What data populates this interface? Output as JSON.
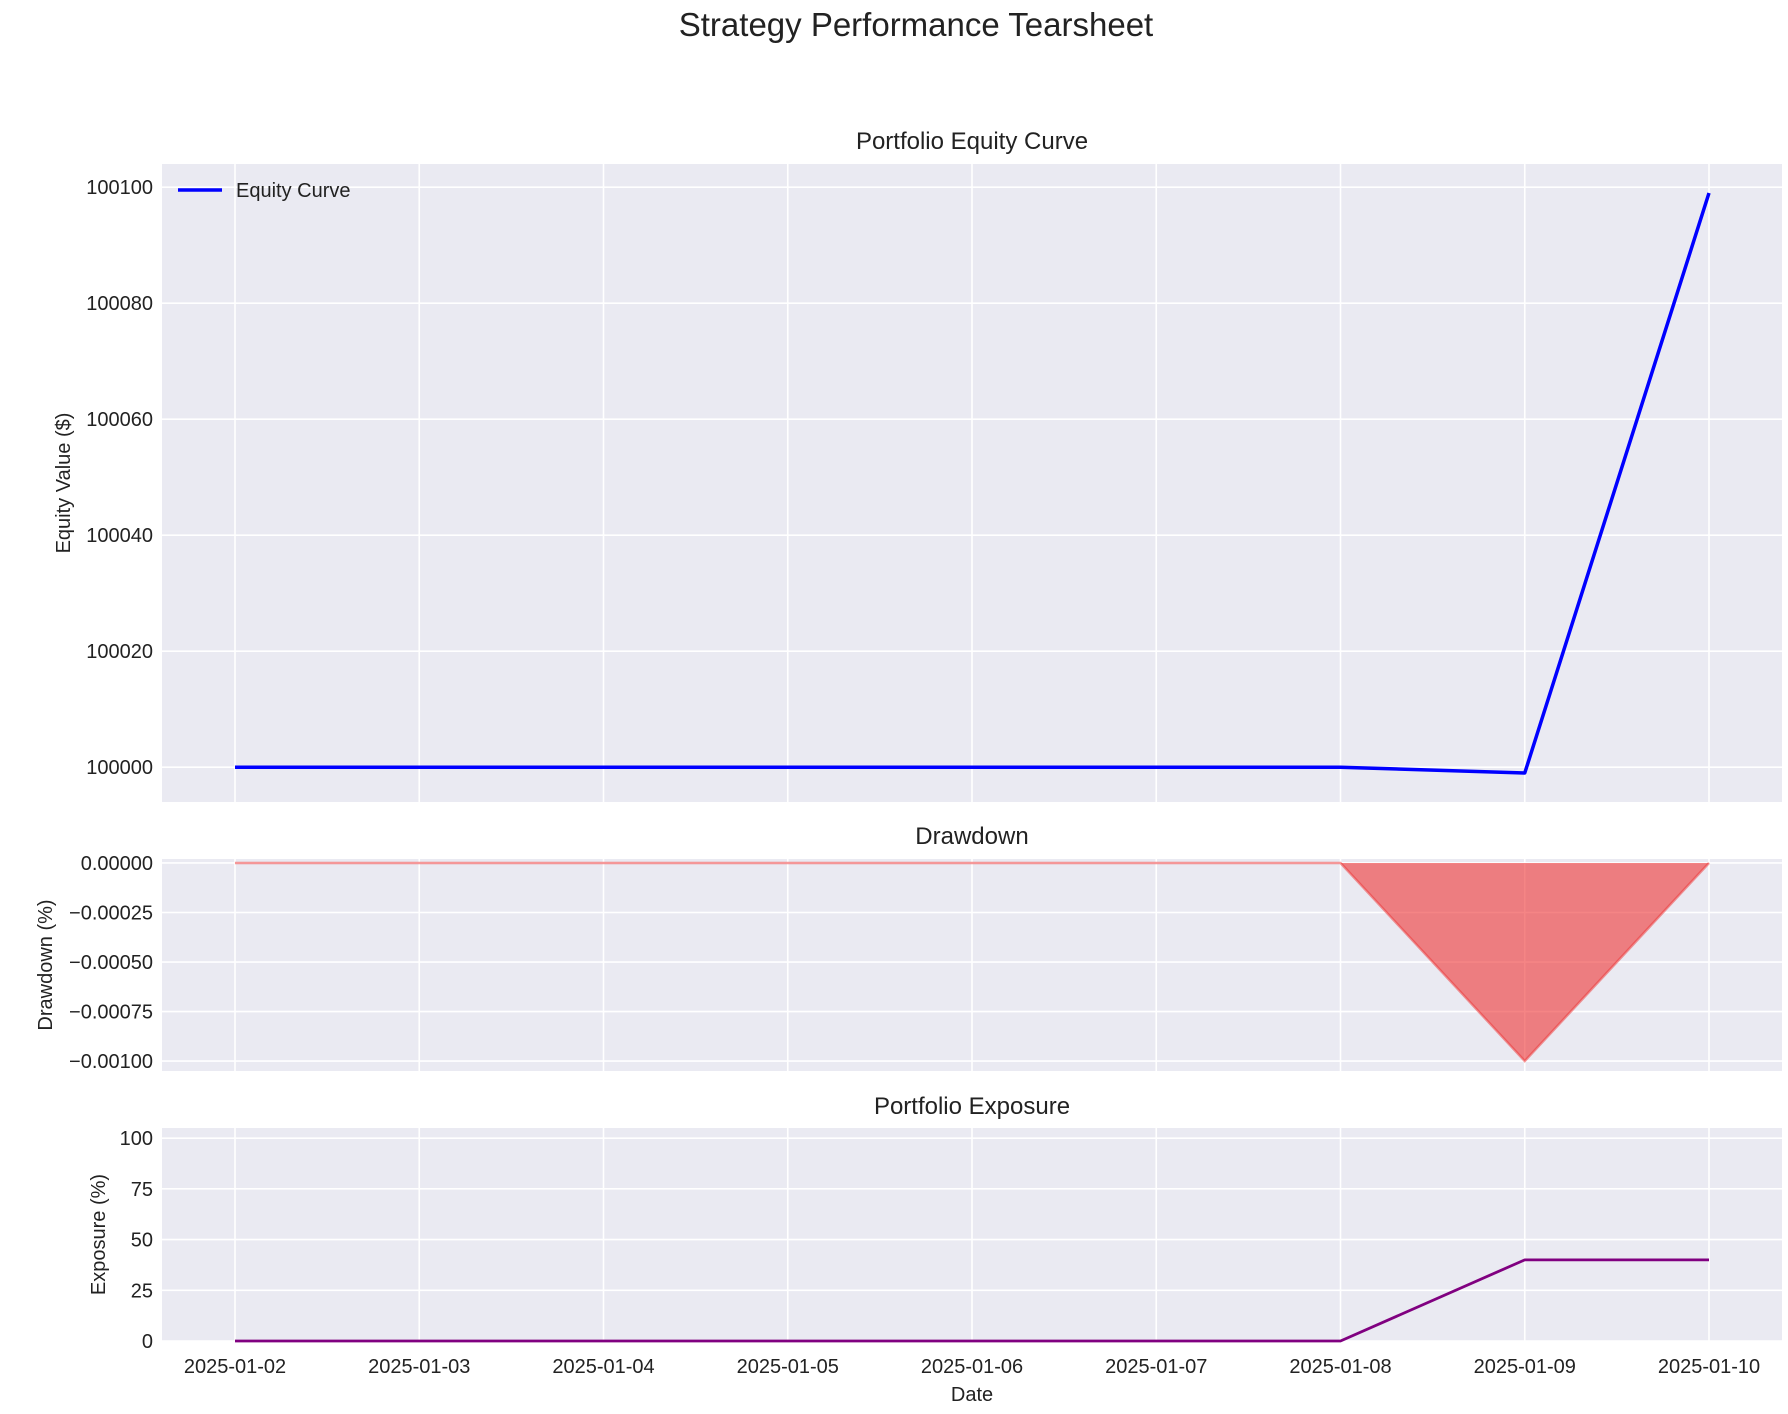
{
  "figure": {
    "title": "Strategy Performance Tearsheet"
  },
  "chart_data": [
    {
      "type": "line",
      "title": "Portfolio Equity Curve",
      "xlabel": "",
      "ylabel": "Equity Value ($)",
      "x": [
        "2025-01-02",
        "2025-01-03",
        "2025-01-04",
        "2025-01-05",
        "2025-01-06",
        "2025-01-07",
        "2025-01-08",
        "2025-01-09",
        "2025-01-10"
      ],
      "series": [
        {
          "name": "Equity Curve",
          "color": "#0000ff",
          "values": [
            100000,
            100000,
            100000,
            100000,
            100000,
            100000,
            100000,
            99999,
            100099
          ]
        }
      ],
      "ylim": [
        99994,
        100104
      ],
      "yticks": [
        100000,
        100020,
        100040,
        100060,
        100080,
        100100
      ],
      "ytick_labels": [
        "100000",
        "100020",
        "100040",
        "100060",
        "100080",
        "100100"
      ],
      "legend": "upper-left",
      "grid": true
    },
    {
      "type": "area",
      "title": "Drawdown",
      "xlabel": "",
      "ylabel": "Drawdown (%)",
      "x": [
        "2025-01-02",
        "2025-01-03",
        "2025-01-04",
        "2025-01-05",
        "2025-01-06",
        "2025-01-07",
        "2025-01-08",
        "2025-01-09",
        "2025-01-10"
      ],
      "series": [
        {
          "color": "#ee3333",
          "values": [
            0,
            0,
            0,
            0,
            0,
            0,
            0,
            -0.001,
            0
          ]
        }
      ],
      "ylim": [
        -0.00105,
        2e-05
      ],
      "yticks": [
        0,
        -0.00025,
        -0.0005,
        -0.00075,
        -0.001
      ],
      "ytick_labels": [
        "0.00000",
        "−0.00025",
        "−0.00050",
        "−0.00075",
        "−0.00100"
      ],
      "grid": true
    },
    {
      "type": "line",
      "title": "Portfolio Exposure",
      "xlabel": "Date",
      "ylabel": "Exposure (%)",
      "x": [
        "2025-01-02",
        "2025-01-03",
        "2025-01-04",
        "2025-01-05",
        "2025-01-06",
        "2025-01-07",
        "2025-01-08",
        "2025-01-09",
        "2025-01-10"
      ],
      "series": [
        {
          "color": "#800080",
          "values": [
            0,
            0,
            0,
            0,
            0,
            0,
            0,
            40,
            40
          ]
        }
      ],
      "ylim": [
        0,
        105
      ],
      "yticks": [
        0,
        25,
        50,
        75,
        100
      ],
      "ytick_labels": [
        "0",
        "25",
        "50",
        "75",
        "100"
      ],
      "xtick_labels": [
        "2025-01-02",
        "2025-01-03",
        "2025-01-04",
        "2025-01-05",
        "2025-01-06",
        "2025-01-07",
        "2025-01-08",
        "2025-01-09",
        "2025-01-10"
      ],
      "grid": true
    }
  ]
}
